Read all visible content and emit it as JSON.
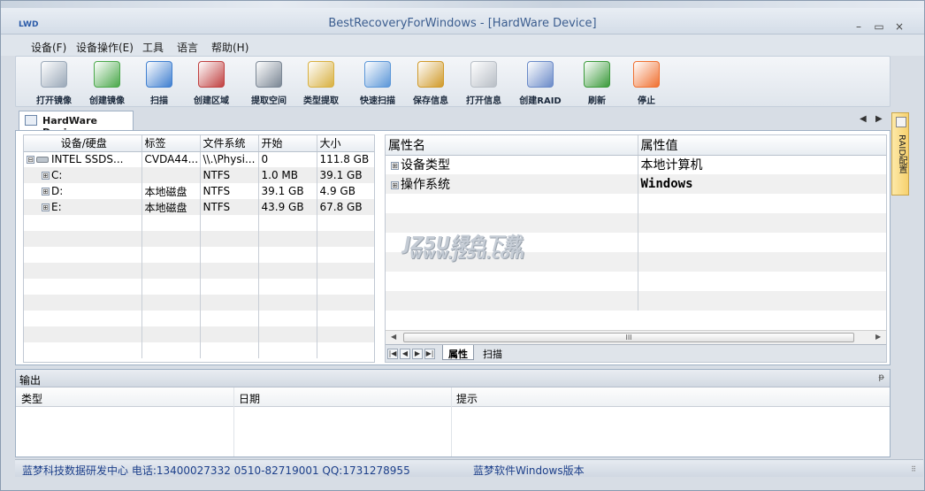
{
  "app": {
    "logo_text": "LWD",
    "title": "BestRecoveryForWindows - [HardWare Device]"
  },
  "window_controls": {
    "minimize": "–",
    "restore": "▭",
    "close": "×"
  },
  "menu": [
    "设备(F)",
    "设备操作(E)",
    "工具",
    "语言",
    "帮助(H)"
  ],
  "toolbar": [
    {
      "label": "打开镜像",
      "icon": "disk-stack-icon",
      "color": "#9aa8b8"
    },
    {
      "label": "创建镜像",
      "icon": "monitor-icon",
      "color": "#4aa84a"
    },
    {
      "label": "扫描",
      "icon": "magnifier-icon",
      "color": "#3f7fd0"
    },
    {
      "label": "创建区域",
      "icon": "region-icon",
      "color": "#c04040"
    },
    {
      "label": "提取空间",
      "icon": "disk-extract-icon",
      "color": "#7a8694"
    },
    {
      "label": "类型提取",
      "icon": "pen-paper-icon",
      "color": "#d8b040"
    },
    {
      "label": "快速扫描",
      "icon": "fast-scan-icon",
      "color": "#5a96d8"
    },
    {
      "label": "保存信息",
      "icon": "floppy-icon",
      "color": "#d09a2a"
    },
    {
      "label": "打开信息",
      "icon": "eraser-icon",
      "color": "#b8bec6"
    },
    {
      "label": "创建RAID",
      "icon": "raid-icon",
      "color": "#6a8ac8"
    },
    {
      "label": "刷新",
      "icon": "refresh-icon",
      "color": "#3a9a3a"
    },
    {
      "label": "停止",
      "icon": "stop-icon",
      "color": "#f07030"
    }
  ],
  "doc_tab": {
    "label": "HardWare Device",
    "prev": "◀",
    "next": "▶"
  },
  "device_table": {
    "columns": [
      "设备/硬盘",
      "标签",
      "文件系统",
      "开始",
      "大小"
    ],
    "rows": [
      {
        "device": "INTEL SSDS...",
        "label": "CVDA44...",
        "fs": "\\\\.\\Physi...",
        "start": "0",
        "size": "111.8 GB",
        "expander": "⊟"
      },
      {
        "device": "C:",
        "label": "",
        "fs": "NTFS",
        "start": "1.0 MB",
        "size": "39.1 GB",
        "expander": "⊞"
      },
      {
        "device": "D:",
        "label": "本地磁盘",
        "fs": "NTFS",
        "start": "39.1 GB",
        "size": "4.9 GB",
        "expander": "⊞"
      },
      {
        "device": "E:",
        "label": "本地磁盘",
        "fs": "NTFS",
        "start": "43.9 GB",
        "size": "67.8 GB",
        "expander": "⊞"
      }
    ]
  },
  "property_table": {
    "columns": [
      "属性名",
      "属性值"
    ],
    "rows": [
      {
        "name": "设备类型",
        "value": "本地计算机",
        "expander": "⊞"
      },
      {
        "name": "操作系统",
        "value": "Windows",
        "expander": "⊞"
      }
    ],
    "scroll_thumb": "III",
    "sheet_nav": [
      "|◀",
      "◀",
      "▶",
      "▶|"
    ],
    "sheet_tabs": [
      "属性",
      "扫描"
    ]
  },
  "watermark": {
    "line1": "JZ5U绿色下载",
    "line2": "www.jz5u.com"
  },
  "side_tab": {
    "label": "RAID配置"
  },
  "output": {
    "title": "输出",
    "pin": "ᵽ",
    "columns": [
      "类型",
      "日期",
      "提示"
    ]
  },
  "status": {
    "left": "蓝梦科技数据研发中心 电话:13400027332 0510-82719001 QQ:1731278955",
    "right": "蓝梦软件Windows版本",
    "grip": "⠿"
  }
}
